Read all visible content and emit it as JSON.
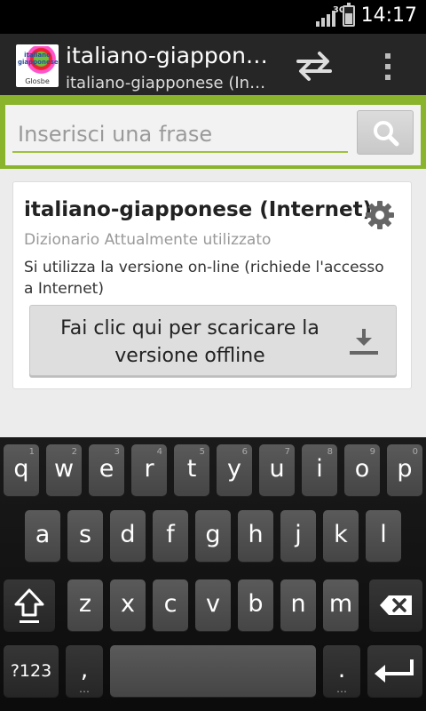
{
  "status_bar": {
    "network": "3G",
    "time": "14:17"
  },
  "action_bar": {
    "app_icon_text": "italiano giapponese",
    "app_icon_brand": "Glosbe",
    "title": "italiano-giapponese (Internet)",
    "subtitle": "italiano-giapponese (Internet)",
    "swap_icon": "swap-arrows-icon",
    "menu_icon": "overflow-menu-icon"
  },
  "search": {
    "placeholder": "Inserisci una frase",
    "value": "",
    "button_icon": "search-icon"
  },
  "dictionary_card": {
    "title": "italiano-giapponese (Internet)",
    "status": "Dizionario Attualmente utilizzato",
    "description": "Si utilizza la versione on-line (richiede l'accesso a Internet)",
    "download_button_label": "Fai clic qui per scaricare la versione offline",
    "settings_icon": "gear-icon",
    "download_icon": "download-icon"
  },
  "keyboard": {
    "row1": [
      {
        "ch": "q",
        "num": "1"
      },
      {
        "ch": "w",
        "num": "2"
      },
      {
        "ch": "e",
        "num": "3"
      },
      {
        "ch": "r",
        "num": "4"
      },
      {
        "ch": "t",
        "num": "5"
      },
      {
        "ch": "y",
        "num": "6"
      },
      {
        "ch": "u",
        "num": "7"
      },
      {
        "ch": "i",
        "num": "8"
      },
      {
        "ch": "o",
        "num": "9"
      },
      {
        "ch": "p",
        "num": "0"
      }
    ],
    "row2": [
      "a",
      "s",
      "d",
      "f",
      "g",
      "h",
      "j",
      "k",
      "l"
    ],
    "row3": [
      "z",
      "x",
      "c",
      "v",
      "b",
      "n",
      "m"
    ],
    "symbols_label": "?123",
    "comma": ",",
    "period": ".",
    "shift_icon": "shift-icon",
    "backspace_icon": "backspace-icon",
    "enter_icon": "enter-icon"
  },
  "colors": {
    "accent": "#8bb42d",
    "action_bar": "#262626",
    "background": "#ececec"
  }
}
